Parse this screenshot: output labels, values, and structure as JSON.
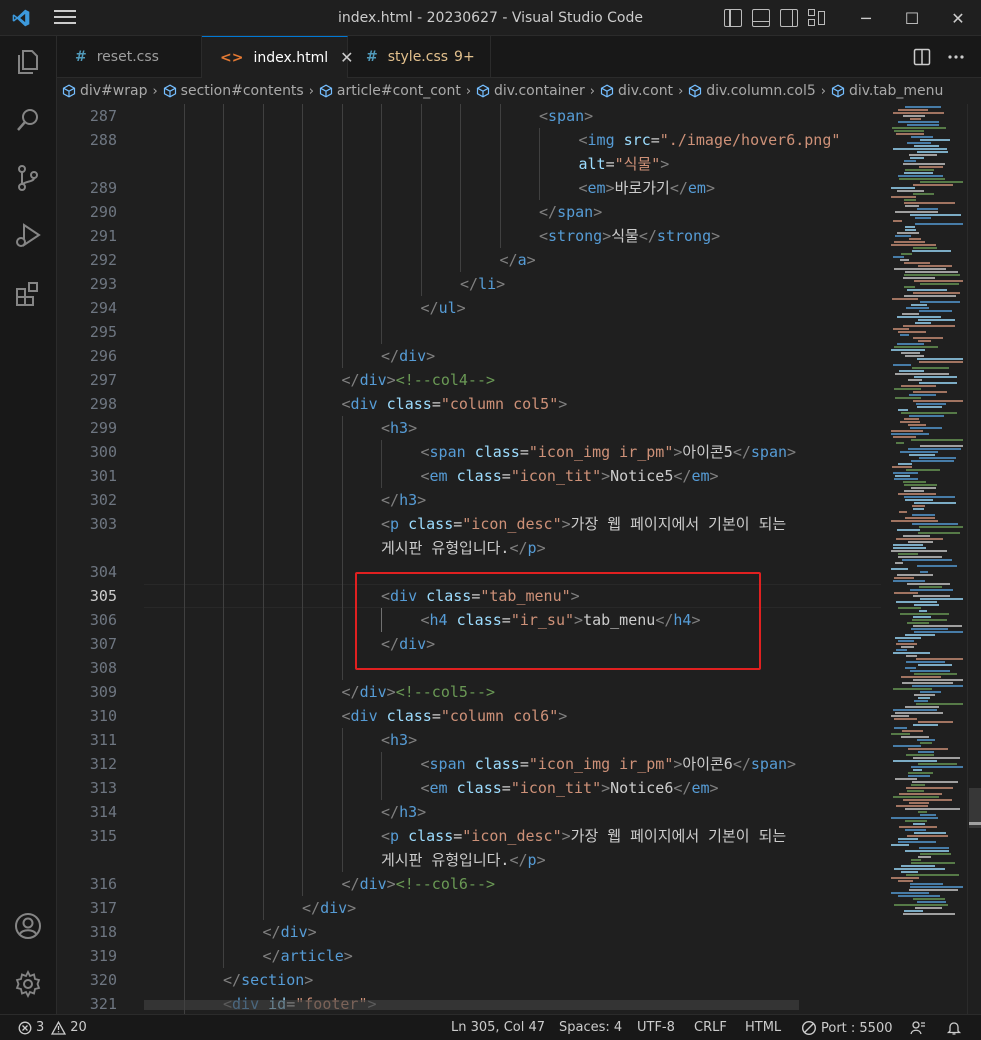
{
  "window": {
    "title": "index.html - 20230627 - Visual Studio Code",
    "controls": {
      "minimize": "─",
      "maximize": "☐",
      "close": "✕"
    }
  },
  "tabs": [
    {
      "label": "reset.css",
      "icon": "#",
      "icon_color": "#519aba",
      "active": false
    },
    {
      "label": "index.html",
      "icon": "<>",
      "icon_color": "#e37933",
      "active": true,
      "close": "✕"
    },
    {
      "label": "style.css",
      "icon": "#",
      "icon_color": "#519aba",
      "active": false,
      "badge": "9+",
      "label_color": "#e2c08d"
    }
  ],
  "breadcrumb": [
    "div#wrap",
    "section#contents",
    "article#cont_cont",
    "div.container",
    "div.cont",
    "div.column.col5",
    "div.tab_menu"
  ],
  "editor": {
    "current_line": "305",
    "lines": [
      {
        "n": "287",
        "indent": 10,
        "tokens": [
          [
            "t-brk",
            "<"
          ],
          [
            "t-tag",
            "span"
          ],
          [
            "t-brk",
            ">"
          ]
        ]
      },
      {
        "n": "288",
        "indent": 11,
        "tokens": [
          [
            "t-brk",
            "<"
          ],
          [
            "t-tag",
            "img"
          ],
          [
            "t-txt",
            " "
          ],
          [
            "t-attr",
            "src"
          ],
          [
            "t-txt",
            "="
          ],
          [
            "t-str",
            "\"./image/hover6.png\""
          ]
        ]
      },
      {
        "n": "",
        "indent": 11,
        "tokens": [
          [
            "t-attr",
            "alt"
          ],
          [
            "t-txt",
            "="
          ],
          [
            "t-str",
            "\"식물\""
          ],
          [
            "t-brk",
            ">"
          ]
        ]
      },
      {
        "n": "289",
        "indent": 11,
        "tokens": [
          [
            "t-brk",
            "<"
          ],
          [
            "t-tag",
            "em"
          ],
          [
            "t-brk",
            ">"
          ],
          [
            "t-txt",
            "바로가기"
          ],
          [
            "t-brk",
            "</"
          ],
          [
            "t-tag",
            "em"
          ],
          [
            "t-brk",
            ">"
          ]
        ]
      },
      {
        "n": "290",
        "indent": 10,
        "tokens": [
          [
            "t-brk",
            "</"
          ],
          [
            "t-tag",
            "span"
          ],
          [
            "t-brk",
            ">"
          ]
        ]
      },
      {
        "n": "291",
        "indent": 10,
        "tokens": [
          [
            "t-brk",
            "<"
          ],
          [
            "t-tag",
            "strong"
          ],
          [
            "t-brk",
            ">"
          ],
          [
            "t-txt",
            "식물"
          ],
          [
            "t-brk",
            "</"
          ],
          [
            "t-tag",
            "strong"
          ],
          [
            "t-brk",
            ">"
          ]
        ]
      },
      {
        "n": "292",
        "indent": 9,
        "tokens": [
          [
            "t-brk",
            "</"
          ],
          [
            "t-tag",
            "a"
          ],
          [
            "t-brk",
            ">"
          ]
        ]
      },
      {
        "n": "293",
        "indent": 8,
        "tokens": [
          [
            "t-brk",
            "</"
          ],
          [
            "t-tag",
            "li"
          ],
          [
            "t-brk",
            ">"
          ]
        ]
      },
      {
        "n": "294",
        "indent": 7,
        "tokens": [
          [
            "t-brk",
            "</"
          ],
          [
            "t-tag",
            "ul"
          ],
          [
            "t-brk",
            ">"
          ]
        ]
      },
      {
        "n": "295",
        "indent": 0,
        "tokens": []
      },
      {
        "n": "296",
        "indent": 6,
        "tokens": [
          [
            "t-brk",
            "</"
          ],
          [
            "t-tag",
            "div"
          ],
          [
            "t-brk",
            ">"
          ]
        ]
      },
      {
        "n": "297",
        "indent": 5,
        "tokens": [
          [
            "t-brk",
            "</"
          ],
          [
            "t-tag",
            "div"
          ],
          [
            "t-brk",
            ">"
          ],
          [
            "t-com",
            "<!--col4-->"
          ]
        ]
      },
      {
        "n": "298",
        "indent": 5,
        "tokens": [
          [
            "t-brk",
            "<"
          ],
          [
            "t-tag",
            "div"
          ],
          [
            "t-txt",
            " "
          ],
          [
            "t-attr",
            "class"
          ],
          [
            "t-txt",
            "="
          ],
          [
            "t-str",
            "\"column col5\""
          ],
          [
            "t-brk",
            ">"
          ]
        ]
      },
      {
        "n": "299",
        "indent": 6,
        "tokens": [
          [
            "t-brk",
            "<"
          ],
          [
            "t-tag",
            "h3"
          ],
          [
            "t-brk",
            ">"
          ]
        ]
      },
      {
        "n": "300",
        "indent": 7,
        "tokens": [
          [
            "t-brk",
            "<"
          ],
          [
            "t-tag",
            "span"
          ],
          [
            "t-txt",
            " "
          ],
          [
            "t-attr",
            "class"
          ],
          [
            "t-txt",
            "="
          ],
          [
            "t-str",
            "\"icon_img ir_pm\""
          ],
          [
            "t-brk",
            ">"
          ],
          [
            "t-txt",
            "아이콘5"
          ],
          [
            "t-brk",
            "</"
          ],
          [
            "t-tag",
            "span"
          ],
          [
            "t-brk",
            ">"
          ]
        ]
      },
      {
        "n": "301",
        "indent": 7,
        "tokens": [
          [
            "t-brk",
            "<"
          ],
          [
            "t-tag",
            "em"
          ],
          [
            "t-txt",
            " "
          ],
          [
            "t-attr",
            "class"
          ],
          [
            "t-txt",
            "="
          ],
          [
            "t-str",
            "\"icon_tit\""
          ],
          [
            "t-brk",
            ">"
          ],
          [
            "t-txt",
            "Notice5"
          ],
          [
            "t-brk",
            "</"
          ],
          [
            "t-tag",
            "em"
          ],
          [
            "t-brk",
            ">"
          ]
        ]
      },
      {
        "n": "302",
        "indent": 6,
        "tokens": [
          [
            "t-brk",
            "</"
          ],
          [
            "t-tag",
            "h3"
          ],
          [
            "t-brk",
            ">"
          ]
        ]
      },
      {
        "n": "303",
        "indent": 6,
        "tokens": [
          [
            "t-brk",
            "<"
          ],
          [
            "t-tag",
            "p"
          ],
          [
            "t-txt",
            " "
          ],
          [
            "t-attr",
            "class"
          ],
          [
            "t-txt",
            "="
          ],
          [
            "t-str",
            "\"icon_desc\""
          ],
          [
            "t-brk",
            ">"
          ],
          [
            "t-txt",
            "가장 웹 페이지에서 기본이 되는"
          ]
        ]
      },
      {
        "n": "",
        "indent": 6,
        "tokens": [
          [
            "t-txt",
            "게시판 유형입니다."
          ],
          [
            "t-brk",
            "</"
          ],
          [
            "t-tag",
            "p"
          ],
          [
            "t-brk",
            ">"
          ]
        ]
      },
      {
        "n": "304",
        "indent": 0,
        "tokens": []
      },
      {
        "n": "305",
        "indent": 6,
        "tokens": [
          [
            "t-brk",
            "<"
          ],
          [
            "t-tag",
            "div"
          ],
          [
            "t-txt",
            " "
          ],
          [
            "t-attr",
            "class"
          ],
          [
            "t-txt",
            "="
          ],
          [
            "t-str",
            "\"tab_menu\""
          ],
          [
            "t-brk",
            ">"
          ]
        ]
      },
      {
        "n": "306",
        "indent": 7,
        "tokens": [
          [
            "t-brk",
            "<"
          ],
          [
            "t-tag",
            "h4"
          ],
          [
            "t-txt",
            " "
          ],
          [
            "t-attr",
            "class"
          ],
          [
            "t-txt",
            "="
          ],
          [
            "t-str",
            "\"ir_su\""
          ],
          [
            "t-brk",
            ">"
          ],
          [
            "t-txt",
            "tab_menu"
          ],
          [
            "t-brk",
            "</"
          ],
          [
            "t-tag",
            "h4"
          ],
          [
            "t-brk",
            ">"
          ]
        ]
      },
      {
        "n": "307",
        "indent": 6,
        "tokens": [
          [
            "t-brk",
            "</"
          ],
          [
            "t-tag",
            "div"
          ],
          [
            "t-brk",
            ">"
          ]
        ]
      },
      {
        "n": "308",
        "indent": 0,
        "tokens": []
      },
      {
        "n": "309",
        "indent": 5,
        "tokens": [
          [
            "t-brk",
            "</"
          ],
          [
            "t-tag",
            "div"
          ],
          [
            "t-brk",
            ">"
          ],
          [
            "t-com",
            "<!--col5-->"
          ]
        ]
      },
      {
        "n": "310",
        "indent": 5,
        "tokens": [
          [
            "t-brk",
            "<"
          ],
          [
            "t-tag",
            "div"
          ],
          [
            "t-txt",
            " "
          ],
          [
            "t-attr",
            "class"
          ],
          [
            "t-txt",
            "="
          ],
          [
            "t-str",
            "\"column col6\""
          ],
          [
            "t-brk",
            ">"
          ]
        ]
      },
      {
        "n": "311",
        "indent": 6,
        "tokens": [
          [
            "t-brk",
            "<"
          ],
          [
            "t-tag",
            "h3"
          ],
          [
            "t-brk",
            ">"
          ]
        ]
      },
      {
        "n": "312",
        "indent": 7,
        "tokens": [
          [
            "t-brk",
            "<"
          ],
          [
            "t-tag",
            "span"
          ],
          [
            "t-txt",
            " "
          ],
          [
            "t-attr",
            "class"
          ],
          [
            "t-txt",
            "="
          ],
          [
            "t-str",
            "\"icon_img ir_pm\""
          ],
          [
            "t-brk",
            ">"
          ],
          [
            "t-txt",
            "아이콘6"
          ],
          [
            "t-brk",
            "</"
          ],
          [
            "t-tag",
            "span"
          ],
          [
            "t-brk",
            ">"
          ]
        ]
      },
      {
        "n": "313",
        "indent": 7,
        "tokens": [
          [
            "t-brk",
            "<"
          ],
          [
            "t-tag",
            "em"
          ],
          [
            "t-txt",
            " "
          ],
          [
            "t-attr",
            "class"
          ],
          [
            "t-txt",
            "="
          ],
          [
            "t-str",
            "\"icon_tit\""
          ],
          [
            "t-brk",
            ">"
          ],
          [
            "t-txt",
            "Notice6"
          ],
          [
            "t-brk",
            "</"
          ],
          [
            "t-tag",
            "em"
          ],
          [
            "t-brk",
            ">"
          ]
        ]
      },
      {
        "n": "314",
        "indent": 6,
        "tokens": [
          [
            "t-brk",
            "</"
          ],
          [
            "t-tag",
            "h3"
          ],
          [
            "t-brk",
            ">"
          ]
        ]
      },
      {
        "n": "315",
        "indent": 6,
        "tokens": [
          [
            "t-brk",
            "<"
          ],
          [
            "t-tag",
            "p"
          ],
          [
            "t-txt",
            " "
          ],
          [
            "t-attr",
            "class"
          ],
          [
            "t-txt",
            "="
          ],
          [
            "t-str",
            "\"icon_desc\""
          ],
          [
            "t-brk",
            ">"
          ],
          [
            "t-txt",
            "가장 웹 페이지에서 기본이 되는"
          ]
        ]
      },
      {
        "n": "",
        "indent": 6,
        "tokens": [
          [
            "t-txt",
            "게시판 유형입니다."
          ],
          [
            "t-brk",
            "</"
          ],
          [
            "t-tag",
            "p"
          ],
          [
            "t-brk",
            ">"
          ]
        ]
      },
      {
        "n": "316",
        "indent": 5,
        "tokens": [
          [
            "t-brk",
            "</"
          ],
          [
            "t-tag",
            "div"
          ],
          [
            "t-brk",
            ">"
          ],
          [
            "t-com",
            "<!--col6-->"
          ]
        ]
      },
      {
        "n": "317",
        "indent": 4,
        "tokens": [
          [
            "t-brk",
            "</"
          ],
          [
            "t-tag",
            "div"
          ],
          [
            "t-brk",
            ">"
          ]
        ]
      },
      {
        "n": "318",
        "indent": 3,
        "tokens": [
          [
            "t-brk",
            "</"
          ],
          [
            "t-tag",
            "div"
          ],
          [
            "t-brk",
            ">"
          ]
        ]
      },
      {
        "n": "319",
        "indent": 3,
        "tokens": [
          [
            "t-brk",
            "</"
          ],
          [
            "t-tag",
            "article"
          ],
          [
            "t-brk",
            ">"
          ]
        ]
      },
      {
        "n": "320",
        "indent": 2,
        "tokens": [
          [
            "t-brk",
            "</"
          ],
          [
            "t-tag",
            "section"
          ],
          [
            "t-brk",
            ">"
          ]
        ]
      },
      {
        "n": "321",
        "indent": 2,
        "tokens": [
          [
            "t-brk",
            "<"
          ],
          [
            "t-tag",
            "div"
          ],
          [
            "t-txt",
            " "
          ],
          [
            "t-attr",
            "id"
          ],
          [
            "t-txt",
            "="
          ],
          [
            "t-str",
            "\"footer\""
          ],
          [
            "t-brk",
            ">"
          ]
        ]
      }
    ]
  },
  "status": {
    "errors": "3",
    "warnings": "20",
    "position": "Ln 305, Col 47",
    "spaces": "Spaces: 4",
    "encoding": "UTF-8",
    "eol": "CRLF",
    "language": "HTML",
    "port": "Port : 5500"
  },
  "colors": {
    "accent": "#0078d4",
    "highlight_box": "#e02020",
    "tag": "#569cd6",
    "attribute": "#9cdcfe",
    "string": "#ce9178",
    "comment": "#6a9955"
  }
}
